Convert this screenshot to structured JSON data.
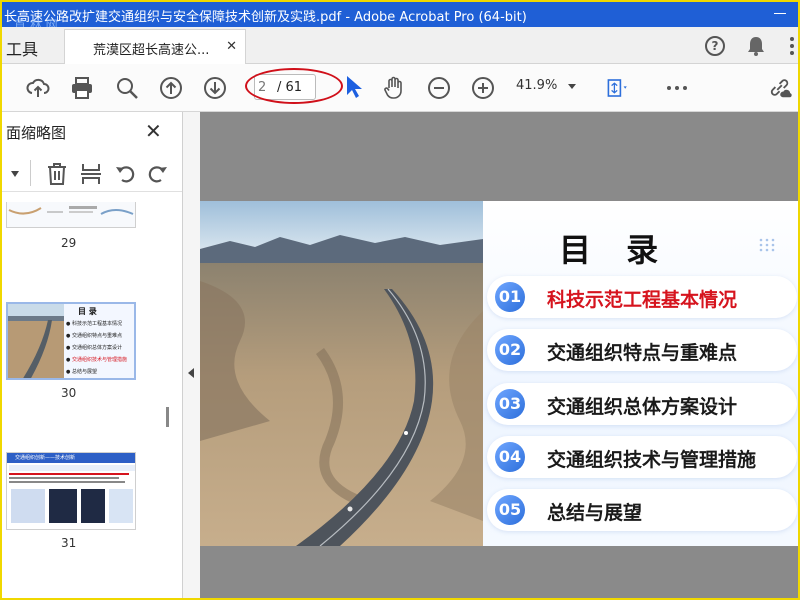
{
  "window": {
    "title": "长高速公路改扩建交通组织与安全保障技术创新及实践.pdf - Adobe Acrobat Pro (64-bit)",
    "watermark": "首 林 网"
  },
  "tabs": {
    "tools_label": "工具",
    "doc_tab_label": "荒漠区超长高速公...",
    "close_symbol": "✕"
  },
  "toolbar": {
    "current_page": "2",
    "total_pages": "/ 61",
    "zoom": "41.9%"
  },
  "sidebar": {
    "title": "面缩略图",
    "close_symbol": "✕",
    "thumbnails": [
      {
        "page": "29"
      },
      {
        "page": "30",
        "heading": "目 录",
        "items": [
          "科技示范工程基本情况",
          "交通组织特点与重难点",
          "交通组织总体方案设计",
          "交通组织技术与管理措施",
          "总结与展望"
        ]
      },
      {
        "page": "31",
        "heading": "交通组织创新——技术创新"
      }
    ]
  },
  "slide": {
    "title": "目 录",
    "items": [
      {
        "num": "01",
        "text": "科技示范工程基本情况",
        "highlight": true
      },
      {
        "num": "02",
        "text": "交通组织特点与重难点",
        "highlight": false
      },
      {
        "num": "03",
        "text": "交通组织总体方案设计",
        "highlight": false
      },
      {
        "num": "04",
        "text": "交通组织技术与管理措施",
        "highlight": false
      },
      {
        "num": "05",
        "text": "总结与展望",
        "highlight": false
      }
    ]
  },
  "colors": {
    "titlebar": "#1f5fd6",
    "highlight_text": "#d6141e",
    "annotation_oval": "#d0101a",
    "cursor": "#1c5fe0"
  },
  "icons": [
    "upload-icon",
    "print-icon",
    "search-icon",
    "page-up-icon",
    "page-down-icon",
    "cursor-arrow-icon",
    "hand-tool-icon",
    "zoom-out-icon",
    "zoom-in-icon",
    "fit-page-icon",
    "more-icon",
    "link-cloud-icon",
    "help-icon",
    "bell-icon"
  ]
}
